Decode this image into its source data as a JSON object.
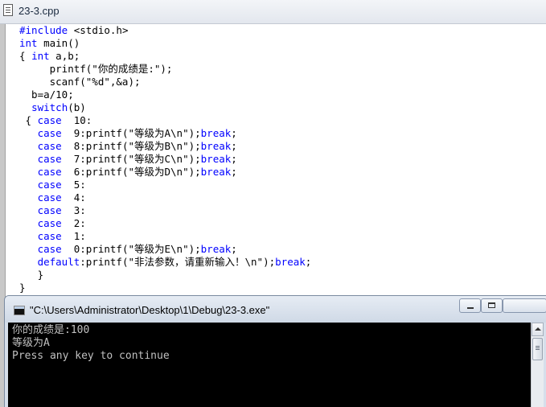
{
  "editor": {
    "title": "23-3.cpp",
    "lines": [
      [
        {
          "t": "#include",
          "k": true
        },
        {
          "t": " <stdio.h>"
        }
      ],
      [
        {
          "t": "int",
          "k": true
        },
        {
          "t": " main()"
        }
      ],
      [
        {
          "t": "{ "
        },
        {
          "t": "int",
          "k": true
        },
        {
          "t": " a,b;"
        }
      ],
      [
        {
          "t": "     printf(\"你的成绩是:\");"
        }
      ],
      [
        {
          "t": "     scanf(\"%d\",&a);"
        }
      ],
      [
        {
          "t": "  b=a/10;"
        }
      ],
      [
        {
          "t": "  "
        },
        {
          "t": "switch",
          "k": true
        },
        {
          "t": "(b)"
        }
      ],
      [
        {
          "t": " { "
        },
        {
          "t": "case",
          "k": true
        },
        {
          "t": "  10:"
        }
      ],
      [
        {
          "t": "   "
        },
        {
          "t": "case",
          "k": true
        },
        {
          "t": "  9:printf(\"等级为A\\n\");"
        },
        {
          "t": "break",
          "k": true
        },
        {
          "t": ";"
        }
      ],
      [
        {
          "t": "   "
        },
        {
          "t": "case",
          "k": true
        },
        {
          "t": "  8:printf(\"等级为B\\n\");"
        },
        {
          "t": "break",
          "k": true
        },
        {
          "t": ";"
        }
      ],
      [
        {
          "t": "   "
        },
        {
          "t": "case",
          "k": true
        },
        {
          "t": "  7:printf(\"等级为C\\n\");"
        },
        {
          "t": "break",
          "k": true
        },
        {
          "t": ";"
        }
      ],
      [
        {
          "t": "   "
        },
        {
          "t": "case",
          "k": true
        },
        {
          "t": "  6:printf(\"等级为D\\n\");"
        },
        {
          "t": "break",
          "k": true
        },
        {
          "t": ";"
        }
      ],
      [
        {
          "t": "   "
        },
        {
          "t": "case",
          "k": true
        },
        {
          "t": "  5:"
        }
      ],
      [
        {
          "t": "   "
        },
        {
          "t": "case",
          "k": true
        },
        {
          "t": "  4:"
        }
      ],
      [
        {
          "t": "   "
        },
        {
          "t": "case",
          "k": true
        },
        {
          "t": "  3:"
        }
      ],
      [
        {
          "t": "   "
        },
        {
          "t": "case",
          "k": true
        },
        {
          "t": "  2:"
        }
      ],
      [
        {
          "t": "   "
        },
        {
          "t": "case",
          "k": true
        },
        {
          "t": "  1:"
        }
      ],
      [
        {
          "t": "   "
        },
        {
          "t": "case",
          "k": true
        },
        {
          "t": "  0:printf(\"等级为E\\n\");"
        },
        {
          "t": "break",
          "k": true
        },
        {
          "t": ";"
        }
      ],
      [
        {
          "t": "   "
        },
        {
          "t": "default",
          "k": true
        },
        {
          "t": ":printf(\"非法参数，请重新输入！\\n\");"
        },
        {
          "t": "break",
          "k": true
        },
        {
          "t": ";"
        }
      ],
      [
        {
          "t": "   }"
        }
      ],
      [
        {
          "t": "}"
        }
      ]
    ]
  },
  "console": {
    "title": "\"C:\\Users\\Administrator\\Desktop\\1\\Debug\\23-3.exe\"",
    "output": [
      "你的成绩是:100",
      "等级为A",
      "Press any key to continue"
    ]
  },
  "colors": {
    "keyword": "#0000ff",
    "console_bg": "#000000",
    "console_text": "#c0c0c0"
  },
  "icons": {
    "editor": "document-icon",
    "console": "console-app-icon",
    "minimize": "minimize-icon",
    "maximize": "maximize-icon",
    "close": "close-icon"
  }
}
